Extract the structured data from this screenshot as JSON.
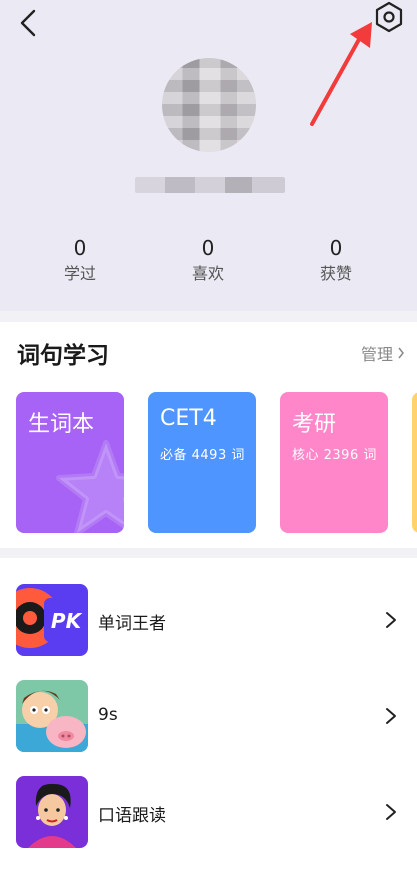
{
  "header": {
    "back_icon": "chevron-left-icon",
    "settings_icon": "hexagon-settings-icon",
    "annotation_color": "#f23b3b"
  },
  "profile": {
    "stats": [
      {
        "value": "0",
        "label": "学过"
      },
      {
        "value": "0",
        "label": "喜欢"
      },
      {
        "value": "0",
        "label": "获赞"
      }
    ]
  },
  "vocab_section": {
    "title": "词句学习",
    "manage_label": "管理",
    "cards": [
      {
        "title": "生词本",
        "subtitle": "",
        "color": "#a663f5"
      },
      {
        "title": "CET4",
        "subtitle": "必备 4493 词",
        "color": "#4f95ff"
      },
      {
        "title": "考研",
        "subtitle": "核心 2396 词",
        "color": "#ff86c9"
      }
    ]
  },
  "list": {
    "items": [
      {
        "label": "单词王者",
        "icon": "pk-badge-icon"
      },
      {
        "label": "9s",
        "icon": "cartoon-characters-icon"
      },
      {
        "label": "口语跟读",
        "icon": "cartoon-woman-icon"
      }
    ]
  }
}
